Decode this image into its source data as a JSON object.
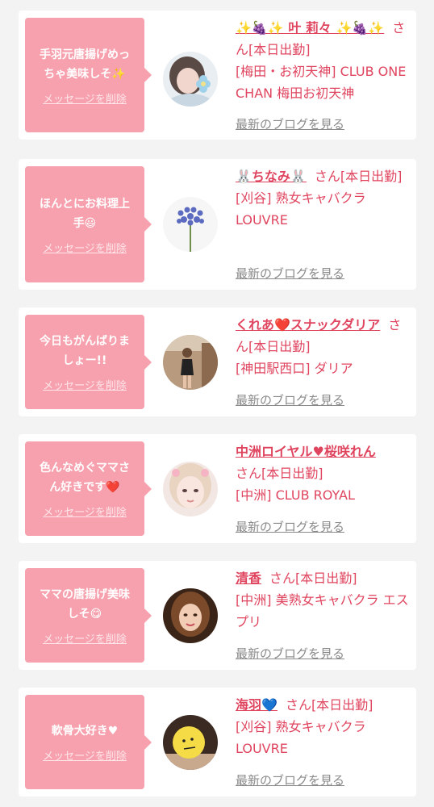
{
  "delete_label": "メッセージを削除",
  "blog_label": "最新のブログを見る",
  "suffix": "さん[本日出勤]",
  "colors": {
    "bubble": "#f7a1ae",
    "accent": "#e0455f",
    "link_gray": "#8a8a8a"
  },
  "cards": [
    {
      "message": "手羽元唐揚げめっ\nちゃ美味しそ✨",
      "name": "✨🍇✨ 叶 莉々 ✨🍇✨",
      "store": "[梅田・お初天神] CLUB ONE CHAN 梅田お初天神",
      "avatar_icon": "woman-with-flower-avatar"
    },
    {
      "message": "ほんとにお料理上\n手😃",
      "name": "🐰ちなみ🐰",
      "store": "[刈谷] 熟女キャバクラ LOUVRE",
      "avatar_icon": "purple-flower-avatar"
    },
    {
      "message": "今日もがんばりま\nしょー!!",
      "name": "くれあ❤️スナックダリア",
      "store": "[神田駅西口] ダリア",
      "avatar_icon": "woman-standing-avatar"
    },
    {
      "message": "色んなめぐママさ\nん好きです❤️",
      "name": "中洲ロイヤル♥桜咲れん",
      "store": "[中洲] CLUB ROYAL",
      "avatar_icon": "woman-face-avatar"
    },
    {
      "message": "ママの唐揚げ美味\nしそ😋",
      "name": "清香",
      "store": "[中洲] 美熟女キャバクラ エスプリ",
      "avatar_icon": "woman-portrait-avatar"
    },
    {
      "message": "軟骨大好き♥",
      "name": "海羽💙",
      "store": "[刈谷] 熟女キャバクラ LOUVRE",
      "avatar_icon": "smiley-face-avatar"
    }
  ]
}
